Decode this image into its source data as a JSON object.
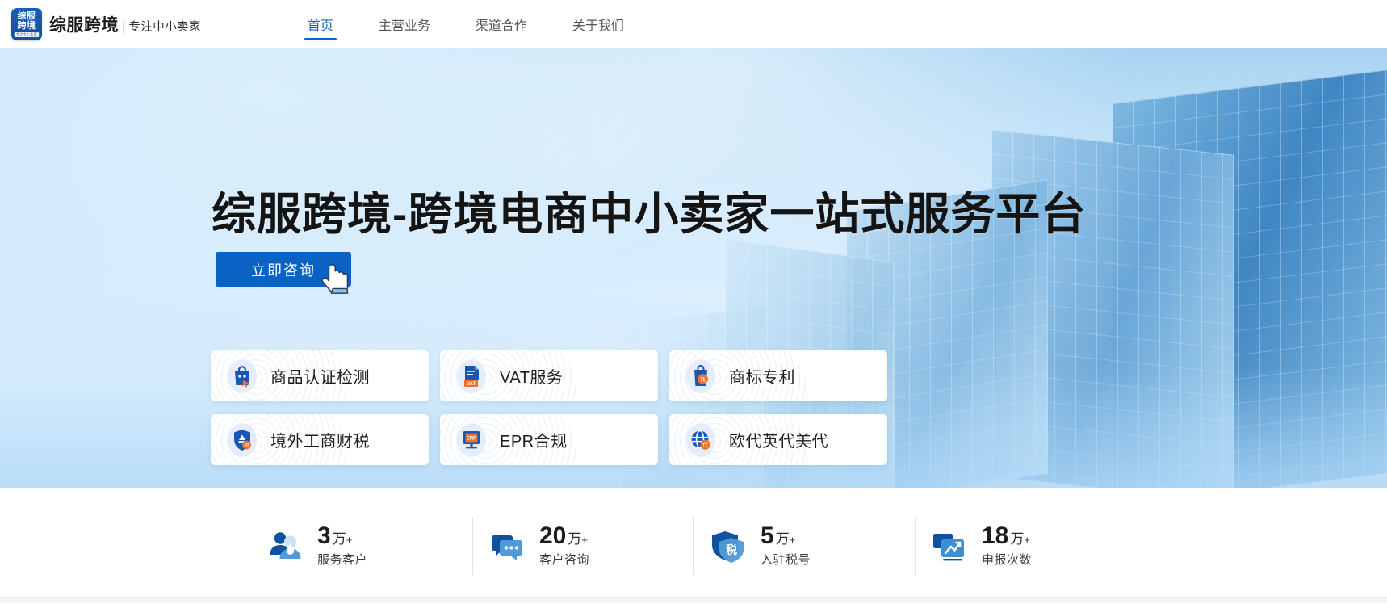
{
  "header": {
    "logo": {
      "name": "zongfu-kuajing-logo",
      "line1": "综服",
      "line2": "跨境",
      "line3": "专注中小卖家"
    },
    "brand_name": "综服跨境",
    "brand_divider": "|",
    "brand_tagline": "专注中小卖家",
    "nav": [
      {
        "label": "首页",
        "active": true
      },
      {
        "label": "主营业务",
        "active": false
      },
      {
        "label": "渠道合作",
        "active": false
      },
      {
        "label": "关于我们",
        "active": false
      }
    ]
  },
  "hero": {
    "title": "综服跨境-跨境电商中小卖家一站式服务平台",
    "cta_label": "立即咨询",
    "cta_color": "#0a63c4",
    "cursor_icon": "hand-pointer-icon",
    "cards": [
      {
        "label": "商品认证检测",
        "icon": "certification-bag-icon"
      },
      {
        "label": "VAT服务",
        "icon": "vat-document-icon"
      },
      {
        "label": "商标专利",
        "icon": "trademark-r-icon"
      },
      {
        "label": "境外工商财税",
        "icon": "overseas-tax-shield-icon"
      },
      {
        "label": "EPR合规",
        "icon": "epr-monitor-icon"
      },
      {
        "label": "欧代英代美代",
        "icon": "globe-agent-icon"
      }
    ]
  },
  "stats": [
    {
      "number": "3",
      "unit": "万",
      "plus": "+",
      "name": "服务客户",
      "icon": "users-icon"
    },
    {
      "number": "20",
      "unit": "万",
      "plus": "+",
      "name": "客户咨询",
      "icon": "chat-bubbles-icon"
    },
    {
      "number": "5",
      "unit": "万",
      "plus": "+",
      "name": "入驻税号",
      "icon": "tax-shield-icon"
    },
    {
      "number": "18",
      "unit": "万",
      "plus": "+",
      "name": "申报次数",
      "icon": "chart-trend-icon"
    }
  ],
  "theme": {
    "accent": "#1563c4",
    "button_blue": "#0a63c4",
    "orange": "#f0702a",
    "text_dark": "#1a1a1a"
  }
}
